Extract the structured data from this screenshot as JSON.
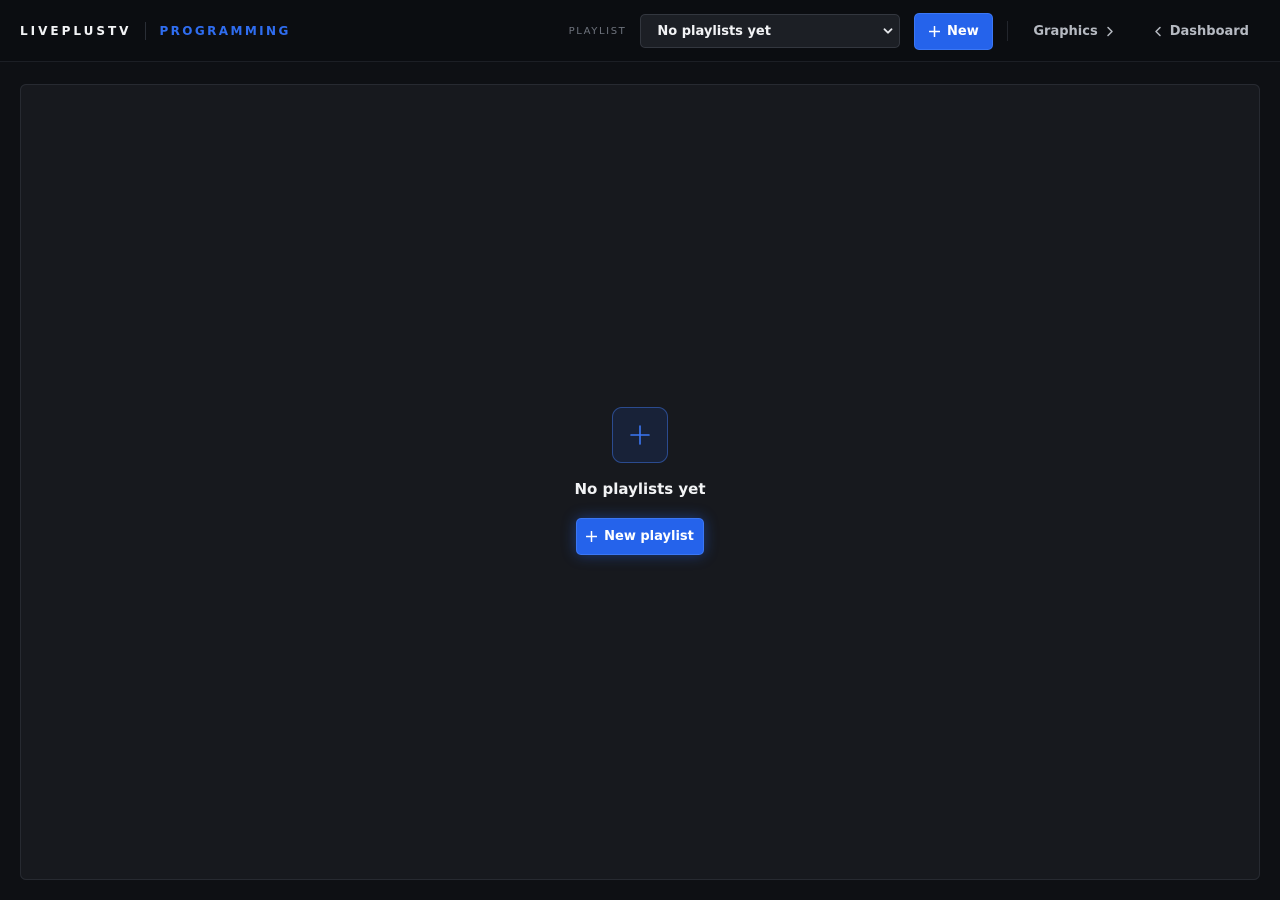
{
  "brand": {
    "name": "LIVEPLUSTV",
    "section": "PROGRAMMING"
  },
  "header": {
    "playlist_label": "PLAYLIST",
    "playlist_select_value": "No playlists yet",
    "new_button_label": "New",
    "graphics_link_label": "Graphics",
    "dashboard_link_label": "Dashboard"
  },
  "empty_state": {
    "title": "No playlists yet",
    "button_label": "New playlist"
  },
  "colors": {
    "accent": "#2563eb",
    "background": "#0e1014",
    "panel": "#17191e"
  },
  "icons": {
    "new_button": "plus-icon",
    "graphics_link": "chevron-right-icon",
    "dashboard_link": "chevron-left-icon",
    "empty_state": "plus-icon",
    "select": "chevron-down-icon"
  }
}
